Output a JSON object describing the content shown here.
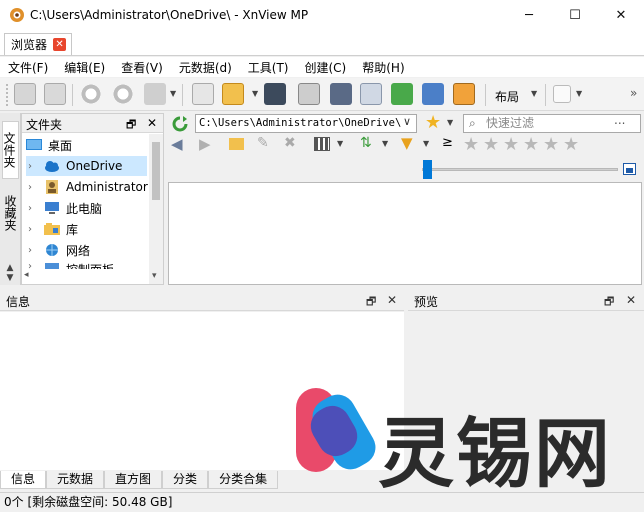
{
  "window": {
    "title": "C:\\Users\\Administrator\\OneDrive\\ - XnView MP",
    "min_glyph": "─",
    "max_glyph": "☐",
    "close_glyph": "✕"
  },
  "tabs": [
    {
      "label": "浏览器",
      "close_glyph": "✕"
    }
  ],
  "menu": [
    "文件(F)",
    "编辑(E)",
    "查看(V)",
    "元数据(d)",
    "工具(T)",
    "创建(C)",
    "帮助(H)"
  ],
  "toolbar": {
    "layout_label": "布局",
    "dropdown_glyph": "▼",
    "more_glyph": "»"
  },
  "sidetabs": {
    "folders": "文件夹",
    "favorites": "收藏夹"
  },
  "folder_panel": {
    "title": "文件夹",
    "pin_glyph": "🗗",
    "close_glyph": "✕",
    "items": [
      {
        "label": "桌面",
        "icon": "desktop-icon",
        "expandable": false
      },
      {
        "label": "OneDrive",
        "icon": "cloud-icon",
        "expandable": true,
        "selected": true
      },
      {
        "label": "Administrator",
        "icon": "user-icon",
        "expandable": true
      },
      {
        "label": "此电脑",
        "icon": "computer-icon",
        "expandable": true
      },
      {
        "label": "库",
        "icon": "library-icon",
        "expandable": true
      },
      {
        "label": "网络",
        "icon": "network-icon",
        "expandable": true
      },
      {
        "label": "控制面板",
        "icon": "control-panel-icon",
        "expandable": true
      }
    ]
  },
  "address": {
    "value": "C:\\Users\\Administrator\\OneDrive\\",
    "dropdown_glyph": "∨"
  },
  "filter": {
    "placeholder": "快速过滤",
    "more_glyph": "..."
  },
  "rating": {
    "ge_symbol": "≥",
    "stars": 5
  },
  "panes": {
    "info_title": "信息",
    "preview_title": "预览",
    "pin_glyph": "🗗",
    "close_glyph": "✕",
    "info_tabs": [
      "信息",
      "元数据",
      "直方图",
      "分类",
      "分类合集"
    ]
  },
  "status": {
    "text": "0个 [剩余磁盘空间: 50.48 GB]"
  },
  "watermark": {
    "text": "灵锡网"
  },
  "colors": {
    "accent": "#0078d7",
    "selected_row": "#cce8ff",
    "tab_close": "#e8462d"
  }
}
